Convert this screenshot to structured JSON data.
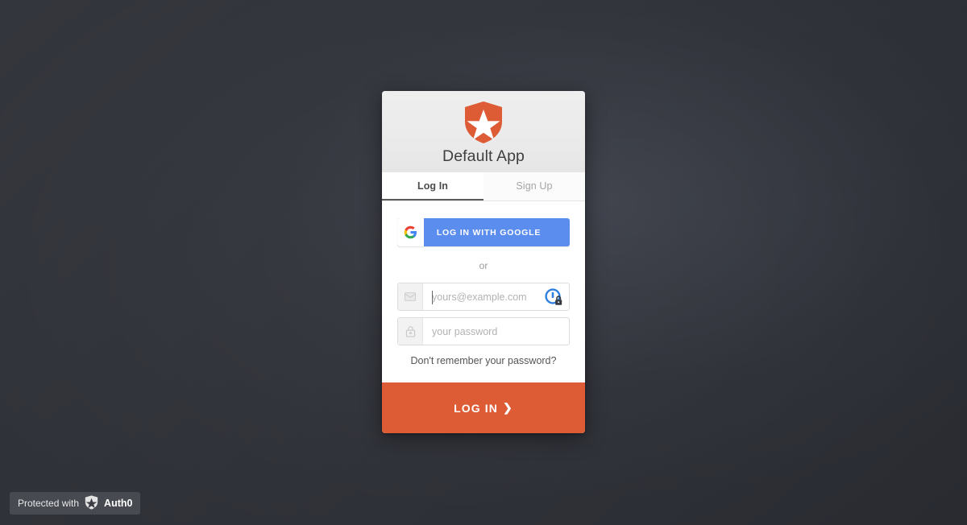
{
  "page": {
    "background_color": "#2f3139",
    "accent_color": "#dd5c35",
    "google_blue": "#5b8def"
  },
  "card": {
    "app_title": "Default App",
    "logo_icon": "auth0-shield-star-icon",
    "tabs": [
      {
        "label": "Log In",
        "active": true
      },
      {
        "label": "Sign Up",
        "active": false
      }
    ],
    "social": {
      "label": "LOG IN WITH GOOGLE",
      "icon": "google-g-icon"
    },
    "separator_text": "or",
    "fields": [
      {
        "name": "email",
        "icon": "envelope-icon",
        "placeholder": "yours@example.com",
        "value": "",
        "autofill_icon": "password-manager-lock-icon"
      },
      {
        "name": "password",
        "icon": "padlock-icon",
        "placeholder": "your password",
        "value": ""
      }
    ],
    "forgot_password_label": "Don't remember your password?",
    "submit": {
      "label": "LOG IN",
      "chevron": "❯"
    }
  },
  "protected_badge": {
    "prefix_text": "Protected with",
    "brand": "Auth0",
    "icon": "auth0-badge-shield-icon"
  }
}
